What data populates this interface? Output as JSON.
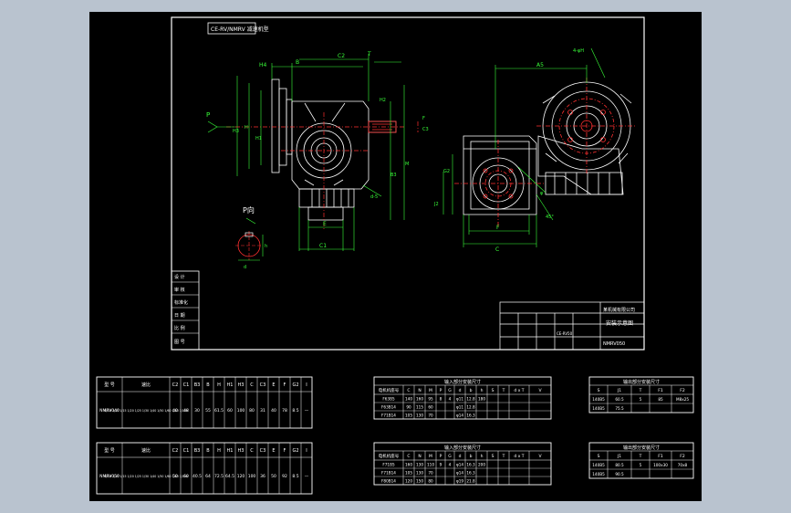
{
  "drawing": {
    "header_label": "CE-RV/NMRV 减速机型",
    "view_p_label": "P向",
    "install_label": "安装示意图",
    "dim_labels": {
      "left_view": [
        "H4",
        "B",
        "C2",
        "T",
        "P",
        "H3",
        "H",
        "B3",
        "M",
        "C1",
        "E",
        "H2",
        "F",
        "C3",
        "H1",
        "d-5"
      ],
      "right_view": [
        "A5",
        "D",
        "d-5",
        "G2",
        "J2",
        "H1",
        "F",
        "C",
        "45°",
        "φ",
        "4-φH"
      ],
      "view_p": [
        "h",
        "d"
      ]
    },
    "left_title_block": [
      "设 计",
      "审 核",
      "标准化",
      "日 期",
      "比 例",
      "图 号"
    ],
    "title_block": {
      "company": "某机械有限公司",
      "drawing_name": "安装示意图",
      "part": "NMRV050",
      "code": "CE-RV50"
    }
  },
  "tables": {
    "model_table": {
      "headers": [
        "型 号",
        "速比",
        "C2",
        "C1",
        "B3",
        "B",
        "H",
        "H1",
        "H3",
        "C",
        "C3",
        "E",
        "F",
        "G2",
        "I"
      ],
      "rows": [
        [
          "NMRV040",
          "1/7.5 1/10 1/15 1/20 1/25 1/30 1/40 1/50 1/60 1/80 1/100",
          "40",
          "48",
          "30",
          "55",
          "61.5",
          "60",
          "100",
          "80",
          "31",
          "40",
          "78",
          "8.5",
          "—"
        ]
      ]
    },
    "model_table_2": {
      "headers": [
        "型 号",
        "速比",
        "C2",
        "C1",
        "B3",
        "B",
        "H",
        "H1",
        "H3",
        "C",
        "C3",
        "E",
        "F",
        "G2",
        "I"
      ],
      "rows": [
        [
          "NMRV050",
          "1/7.5 1/10 1/15 1/20 1/25 1/30 1/40 1/50 1/60 1/80 1/100",
          "50",
          "60",
          "40.5",
          "64",
          "72.5",
          "64.5",
          "120",
          "100",
          "36",
          "50",
          "92",
          "8.5",
          "—"
        ]
      ]
    },
    "input_table": {
      "caption": "输入部分安装尺寸",
      "headers": [
        "电机机座号",
        "C",
        "N",
        "M",
        "P",
        "G",
        "d",
        "b",
        "h",
        "S",
        "T",
        "d x T",
        "V"
      ],
      "rows": [
        [
          "F63B5",
          "140",
          "160",
          "95",
          "8",
          "4",
          "φ11",
          "12.8",
          "180",
          "",
          "",
          "",
          ""
        ],
        [
          "F63B14",
          "90",
          "115",
          "60",
          "",
          "",
          "φ11",
          "12.8",
          "",
          "",
          "",
          "",
          ""
        ],
        [
          "F71B14",
          "105",
          "130",
          "70",
          "",
          "",
          "φ14",
          "16.3",
          "",
          "",
          "",
          "",
          ""
        ]
      ],
      "merged": {
        "S": "21",
        "T": "11.5",
        "dxT": "4xφ12.5"
      }
    },
    "input_table_2": {
      "caption": "输入部分安装尺寸",
      "headers": [
        "电机机座号",
        "C",
        "N",
        "M",
        "P",
        "G",
        "d",
        "b",
        "h",
        "S",
        "T",
        "d x T",
        "V"
      ],
      "rows": [
        [
          "F71B5",
          "160",
          "130",
          "110",
          "9",
          "4",
          "φ14",
          "16.3",
          "200",
          "",
          "",
          "",
          ""
        ],
        [
          "F71B14",
          "105",
          "130",
          "70",
          "",
          "",
          "φ14",
          "16.3",
          "",
          "",
          "",
          "",
          ""
        ],
        [
          "F80B14",
          "120",
          "150",
          "80",
          "",
          "",
          "φ19",
          "21.8",
          "",
          "",
          "",
          "",
          ""
        ]
      ],
      "merged": {
        "S": "30",
        "T": "14.5",
        "dxT": "8xφ10",
        "V": "100x25"
      }
    },
    "output_table": {
      "caption": "输出部分安装尺寸",
      "headers": [
        "S",
        "J1",
        "T",
        "F1",
        "F2"
      ],
      "rows": [
        [
          "140B5",
          "60.5",
          "5",
          "85",
          "M8x25"
        ],
        [
          "140B5",
          "75.5",
          "",
          "",
          ""
        ]
      ]
    },
    "output_table_2": {
      "caption": "输出部分安装尺寸",
      "headers": [
        "S",
        "J1",
        "T",
        "F1",
        "F2"
      ],
      "rows": [
        [
          "140B5",
          "80.5",
          "5",
          "100x30",
          "70x8"
        ],
        [
          "140B5",
          "90.5",
          "",
          "",
          ""
        ]
      ]
    }
  },
  "colors": {
    "background": "#b9c3cf",
    "paper": "#000000",
    "line_white": "#ffffff",
    "line_green": "#39ff39",
    "line_red": "#ff3030"
  }
}
